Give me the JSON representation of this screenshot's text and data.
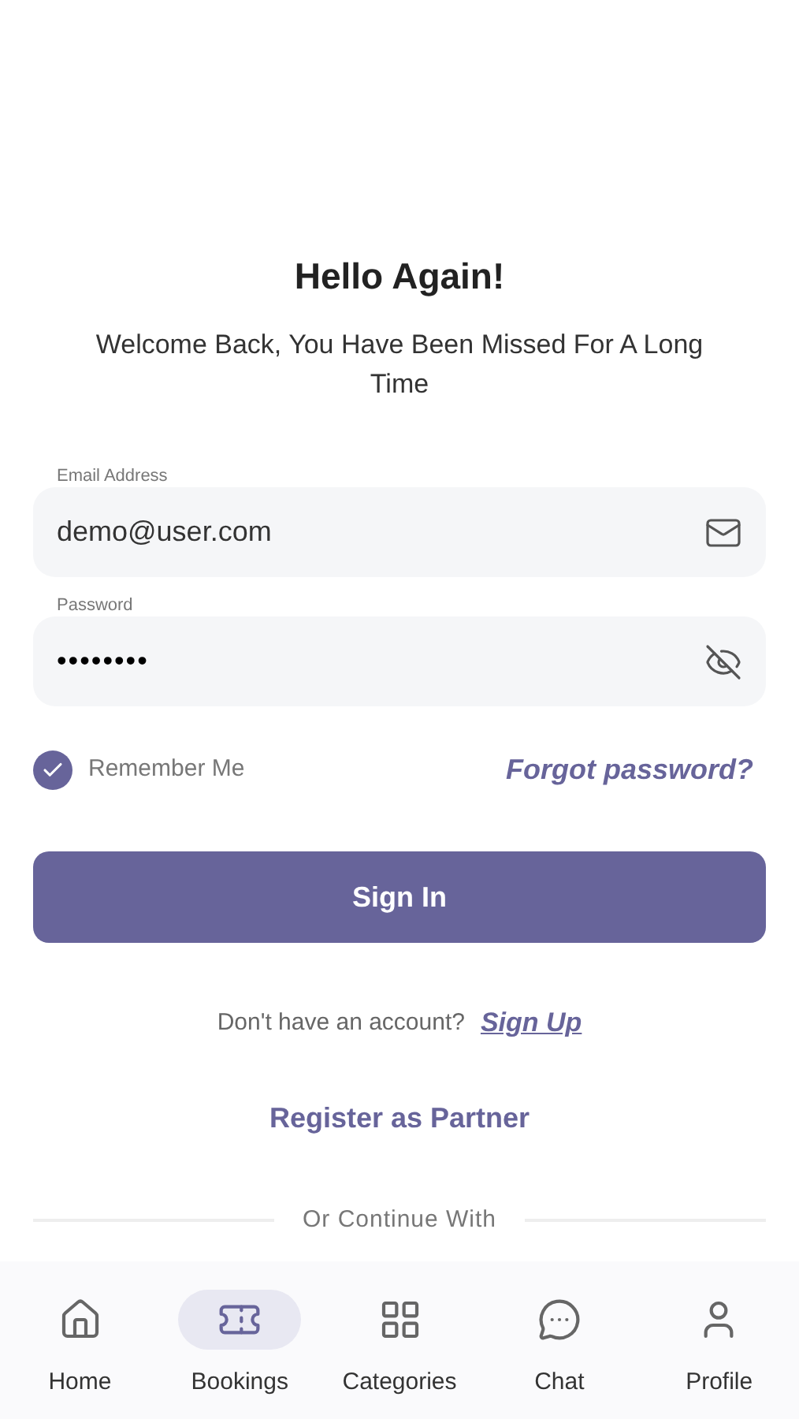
{
  "title": "Hello Again!",
  "subtitle": "Welcome Back, You Have Been Missed For A Long Time",
  "fields": [
    {
      "kind": "email",
      "label": "Email Address",
      "value": "demo@user.com"
    },
    {
      "kind": "password",
      "label": "Password",
      "value": "••••••••"
    }
  ],
  "remember": {
    "label": "Remember Me",
    "checked": true
  },
  "forgot": "Forgot password?",
  "sign_in": "Sign In",
  "signup_prompt": "Don't have an account?",
  "signup_link": "Sign Up",
  "partner": "Register as Partner",
  "divider": "Or Continue With",
  "nav": [
    {
      "kind": "home",
      "label": "Home",
      "selected": false
    },
    {
      "kind": "bookings",
      "label": "Bookings",
      "selected": true
    },
    {
      "kind": "categories",
      "label": "Categories",
      "selected": false
    },
    {
      "kind": "chat",
      "label": "Chat",
      "selected": false
    },
    {
      "kind": "profile",
      "label": "Profile",
      "selected": false
    }
  ]
}
